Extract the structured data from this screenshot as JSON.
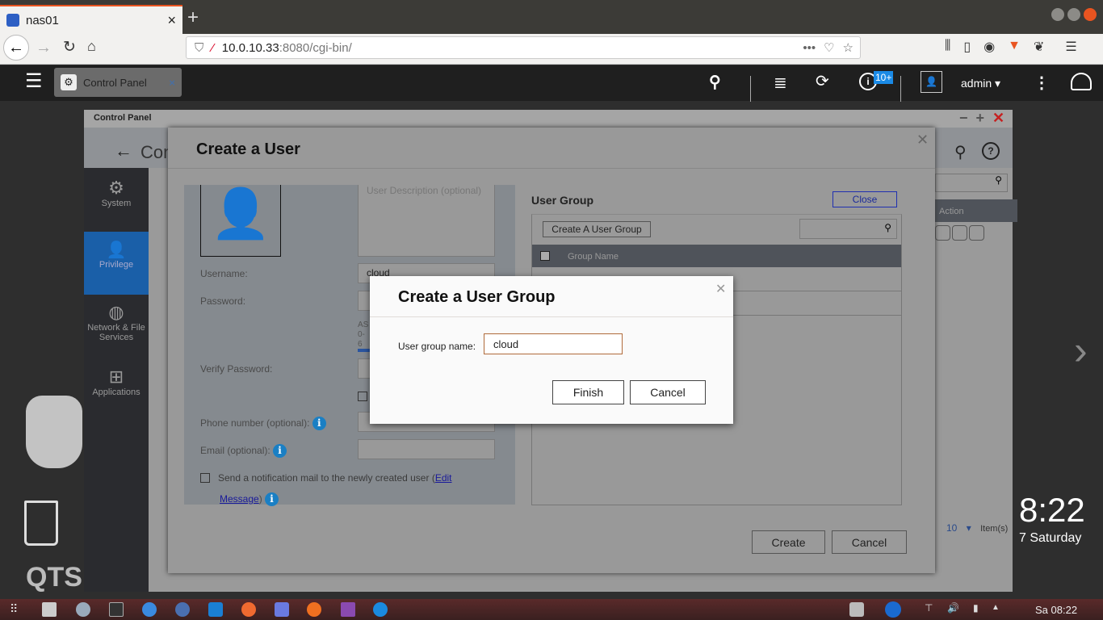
{
  "browser": {
    "tab_title": "nas01",
    "url_host": "10.0.10.33",
    "url_rest": ":8080/cgi-bin/"
  },
  "qts": {
    "app_tab": "Control Panel",
    "notif_badge": "10+",
    "user": "admin",
    "clock_time": "8:22",
    "clock_day": "7 Saturday",
    "brand": "QTS"
  },
  "control_panel": {
    "title": "Control Panel",
    "heading": "Con",
    "sidebar": [
      {
        "label": "System",
        "icon": "gear-icon"
      },
      {
        "label": "Privilege",
        "icon": "user-icon"
      },
      {
        "label": "Network & File Services",
        "icon": "globe-icon"
      },
      {
        "label": "Applications",
        "icon": "apps-icon"
      }
    ],
    "action_header": "Action",
    "page_size": "10",
    "items_label": "Item(s)"
  },
  "create_user": {
    "title": "Create a User",
    "desc_placeholder": "User Description (optional)",
    "username_label": "Username:",
    "username_value": "cloud",
    "password_label": "Password:",
    "pw_hint": "AS 0-6",
    "verify_label": "Verify Password:",
    "phone_label": "Phone number (optional):",
    "email_label": "Email (optional):",
    "notify_text": "Send a notification mail to the newly created user (",
    "edit_link": "Edit",
    "message_link": "Message",
    "close_paren": ")",
    "user_group_title": "User Group",
    "close_btn": "Close",
    "create_group_btn": "Create A User Group",
    "group_name_col": "Group Name",
    "create_btn": "Create",
    "cancel_btn": "Cancel"
  },
  "group_dialog": {
    "title": "Create a User Group",
    "name_label": "User group name:",
    "name_value": "cloud",
    "finish": "Finish",
    "cancel": "Cancel"
  },
  "taskbar": {
    "clock": "Sa 08:22"
  },
  "colors": {
    "accent": "#1a7fc4",
    "privilege_active": "#1a5fa8",
    "ubuntu_orange": "#e95420"
  }
}
